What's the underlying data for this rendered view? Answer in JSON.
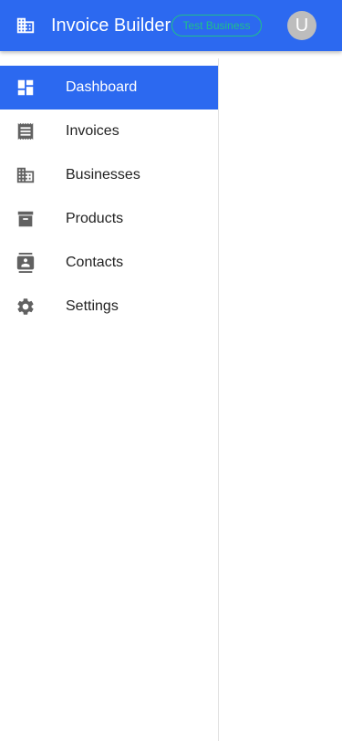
{
  "appbar": {
    "title": "Invoice Builder",
    "business_badge": "Test Business",
    "avatar_initial": "U",
    "logo_icon": "business-icon"
  },
  "sidebar": {
    "items": [
      {
        "label": "Dashboard",
        "icon": "dashboard-icon",
        "active": true
      },
      {
        "label": "Invoices",
        "icon": "receipt-icon",
        "active": false
      },
      {
        "label": "Businesses",
        "icon": "business-icon",
        "active": false
      },
      {
        "label": "Products",
        "icon": "archive-icon",
        "active": false
      },
      {
        "label": "Contacts",
        "icon": "contacts-icon",
        "active": false
      },
      {
        "label": "Settings",
        "icon": "gear-icon",
        "active": false
      }
    ]
  },
  "colors": {
    "primary": "#2c69f0",
    "badge": "#1fbf8a",
    "avatar": "#bdbdbd",
    "icon": "#616161"
  }
}
